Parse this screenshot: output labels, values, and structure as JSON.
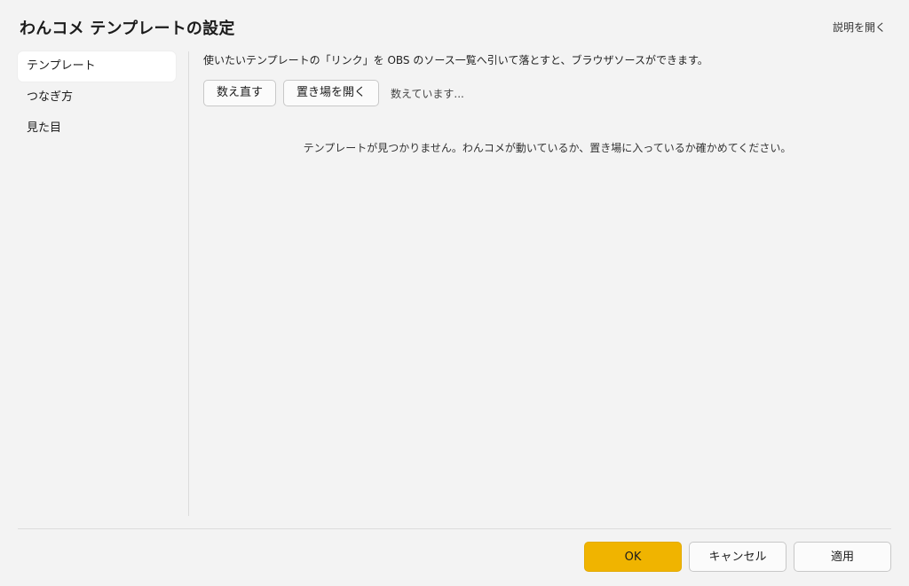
{
  "window": {
    "title": "わんコメ テンプレートの設定",
    "help_link": "説明を開く"
  },
  "sidebar": {
    "items": [
      {
        "label": "テンプレート",
        "active": true
      },
      {
        "label": "つなぎ方",
        "active": false
      },
      {
        "label": "見た目",
        "active": false
      }
    ]
  },
  "main": {
    "description": "使いたいテンプレートの「リンク」を OBS のソース一覧へ引いて落とすと、ブラウザソースができます。",
    "recount_button": "数え直す",
    "open_folder_button": "置き場を開く",
    "status": "数えています...",
    "empty_message": "テンプレートが見つかりません。わんコメが動いているか、置き場に入っているか確かめてください。"
  },
  "footer": {
    "ok_label": "OK",
    "cancel_label": "キャンセル",
    "apply_label": "適用"
  },
  "colors": {
    "accent": "#f0b400",
    "background": "#f3f3f3"
  }
}
